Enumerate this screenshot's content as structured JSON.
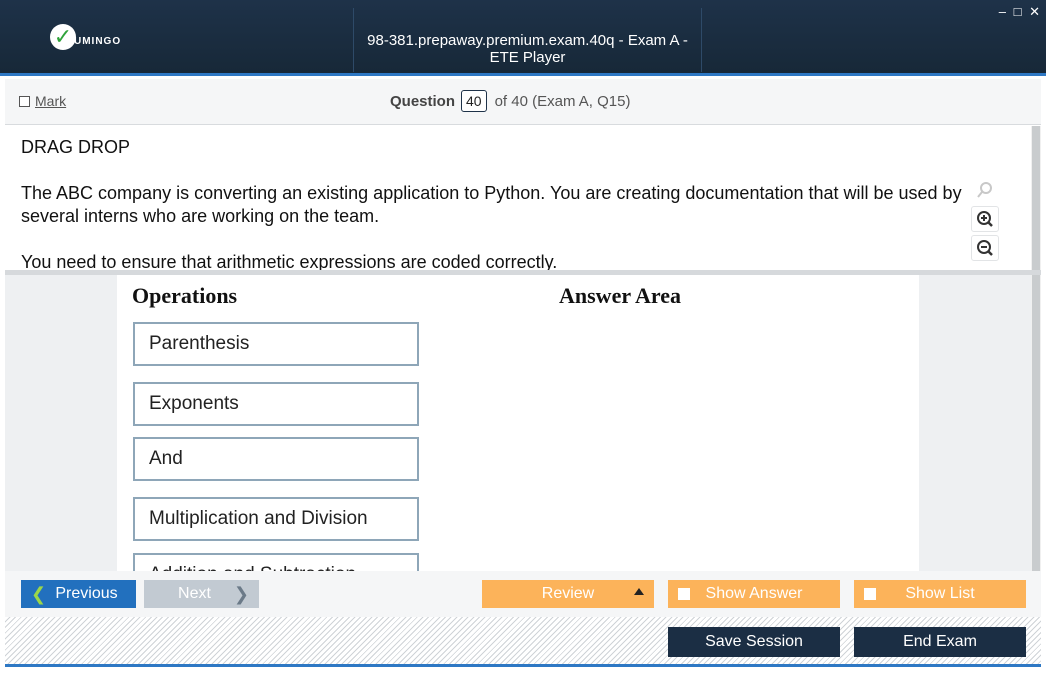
{
  "app": {
    "logo_text": "UMINGO",
    "window_title": "98-381.prepaway.premium.exam.40q - Exam A - ETE Player",
    "controls": {
      "minimize": "–",
      "maximize": "□",
      "close": "✕"
    }
  },
  "question_bar": {
    "mark_label": "Mark",
    "question_label": "Question",
    "question_number": "40",
    "question_suffix": "of 40 (Exam A, Q15)"
  },
  "question": {
    "title": "DRAG DROP",
    "paragraph1": "The ABC company is converting an existing application to Python. You are creating documentation that will be used by several interns who are working on the team.",
    "paragraph2": "You need to ensure that arithmetic expressions are coded correctly."
  },
  "exhibit": {
    "operations_title": "Operations",
    "answer_area_title": "Answer Area",
    "operations": [
      "Parenthesis",
      "Exponents",
      "And",
      "Multiplication and Division",
      "Addition and Subtraction"
    ]
  },
  "nav": {
    "previous_label": "Previous",
    "next_label": "Next",
    "review_label": "Review",
    "show_answer_label": "Show Answer",
    "show_list_label": "Show List",
    "save_session_label": "Save Session",
    "end_exam_label": "End Exam"
  },
  "colors": {
    "titlebar": "#1e3249",
    "accent_blue": "#2270be",
    "orange": "#fcb35a",
    "dark_button": "#1b2e44",
    "check_green": "#2fa33a"
  },
  "icons": {
    "logo": "check-icon",
    "zoom_search": "search-icon",
    "zoom_in": "zoom-in-icon",
    "zoom_out": "zoom-out-icon",
    "previous": "chevron-left-icon",
    "next": "chevron-right-icon",
    "review": "caret-up-icon"
  }
}
